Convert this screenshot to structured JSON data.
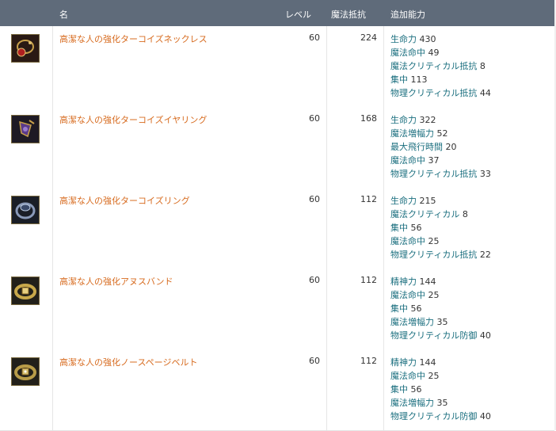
{
  "header": {
    "name": "名",
    "level": "レベル",
    "magic_resist": "魔法抵抗",
    "bonus": "追加能力"
  },
  "rows": [
    {
      "icon": "necklace-icon",
      "name": "高潔な人の強化ターコイズネックレス",
      "level": "60",
      "magic_resist": "224",
      "stats": [
        {
          "label": "生命力",
          "value": "430"
        },
        {
          "label": "魔法命中",
          "value": "49"
        },
        {
          "label": "魔法クリティカル抵抗",
          "value": "8"
        },
        {
          "label": "集中",
          "value": "113"
        },
        {
          "label": "物理クリティカル抵抗",
          "value": "44"
        }
      ]
    },
    {
      "icon": "earring-icon",
      "name": "高潔な人の強化ターコイズイヤリング",
      "level": "60",
      "magic_resist": "168",
      "stats": [
        {
          "label": "生命力",
          "value": "322"
        },
        {
          "label": "魔法増幅力",
          "value": "52"
        },
        {
          "label": "最大飛行時間",
          "value": "20"
        },
        {
          "label": "魔法命中",
          "value": "37"
        },
        {
          "label": "物理クリティカル抵抗",
          "value": "33"
        }
      ]
    },
    {
      "icon": "ring-icon",
      "name": "高潔な人の強化ターコイズリング",
      "level": "60",
      "magic_resist": "112",
      "stats": [
        {
          "label": "生命力",
          "value": "215"
        },
        {
          "label": "魔法クリティカル",
          "value": "8"
        },
        {
          "label": "集中",
          "value": "56"
        },
        {
          "label": "魔法命中",
          "value": "25"
        },
        {
          "label": "物理クリティカル抵抗",
          "value": "22"
        }
      ]
    },
    {
      "icon": "belt-icon",
      "name": "高潔な人の強化アヌスバンド",
      "level": "60",
      "magic_resist": "112",
      "stats": [
        {
          "label": "精神力",
          "value": "144"
        },
        {
          "label": "魔法命中",
          "value": "25"
        },
        {
          "label": "集中",
          "value": "56"
        },
        {
          "label": "魔法増幅力",
          "value": "35"
        },
        {
          "label": "物理クリティカル防御",
          "value": "40"
        }
      ]
    },
    {
      "icon": "belt-icon",
      "name": "高潔な人の強化ノースページベルト",
      "level": "60",
      "magic_resist": "112",
      "stats": [
        {
          "label": "精神力",
          "value": "144"
        },
        {
          "label": "魔法命中",
          "value": "25"
        },
        {
          "label": "集中",
          "value": "56"
        },
        {
          "label": "魔法増幅力",
          "value": "35"
        },
        {
          "label": "物理クリティカル防御",
          "value": "40"
        }
      ]
    }
  ]
}
